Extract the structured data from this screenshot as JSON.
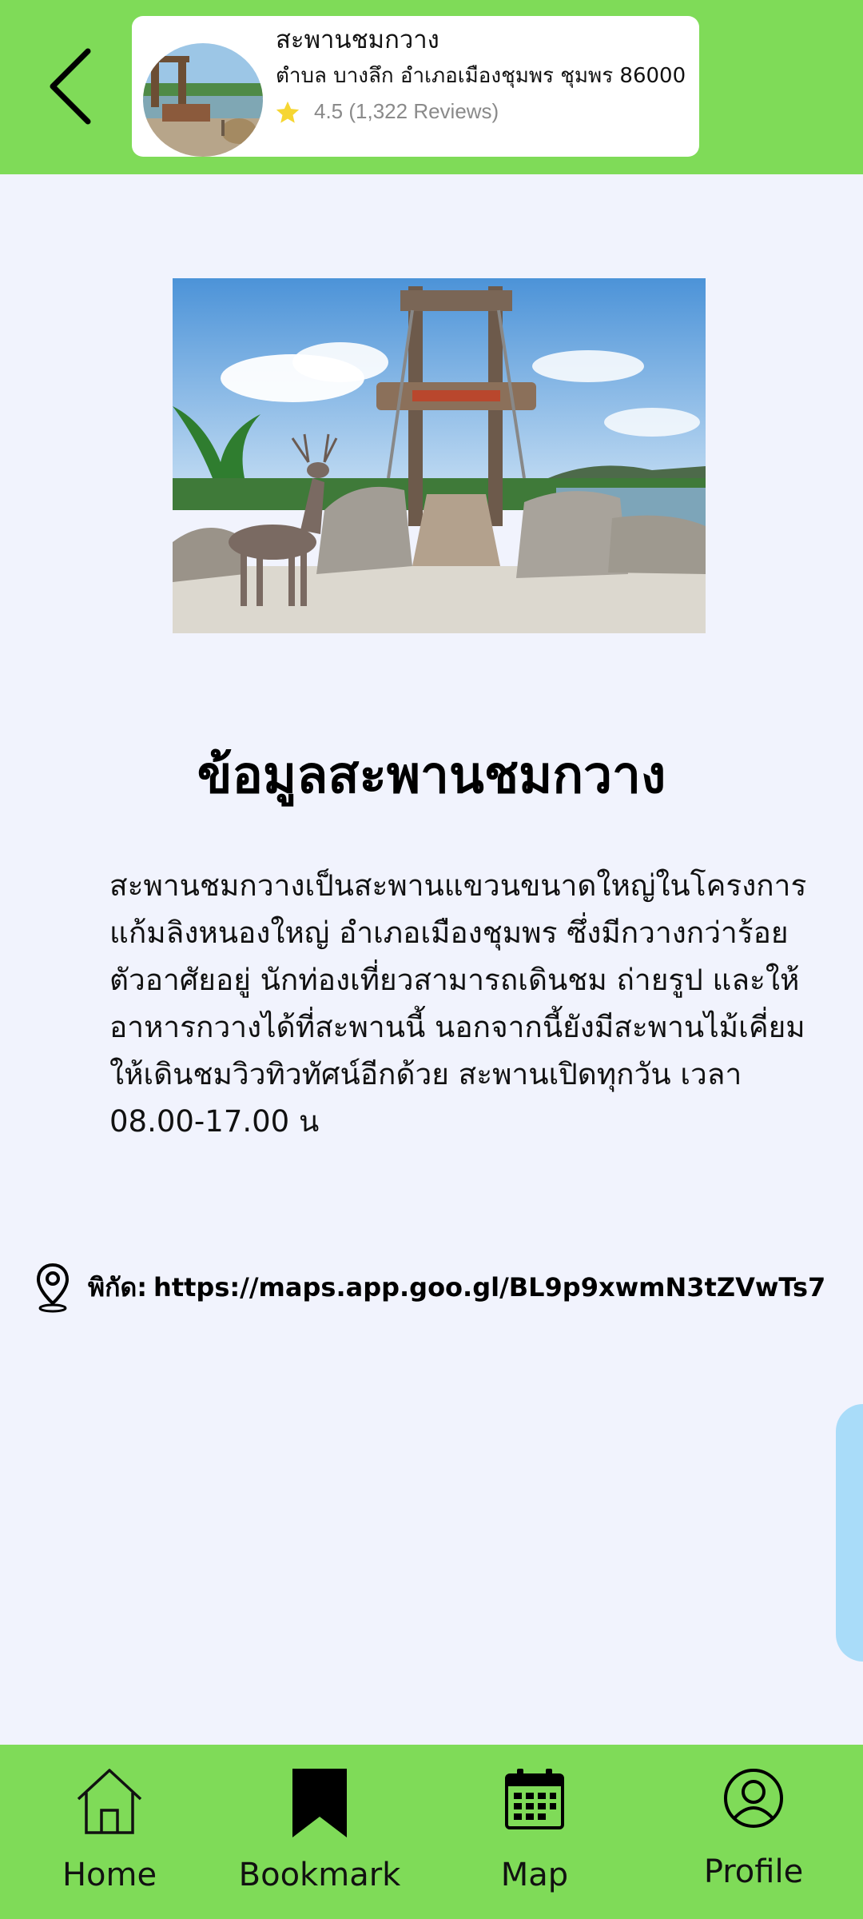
{
  "header": {
    "back_icon": "chevron-left-icon",
    "place": {
      "name": "สะพานชมกวาง",
      "address": "ตำบล บางลึก อำเภอเมืองชุมพร ชุมพร 86000",
      "rating_text": "4.5 (1,322 Reviews)",
      "rating_value": 4.5,
      "review_count": "1,322",
      "star_icon": "star-icon",
      "star_color": "#f6d632"
    }
  },
  "main": {
    "title": "ข้อมูลสะพานชมกวาง",
    "description": "สะพานชมกวางเป็นสะพานแขวนขนาดใหญ่ในโครงการแก้มลิงหนองใหญ่ อำเภอเมืองชุมพร ซึ่งมีกวางกว่าร้อยตัวอาศัยอยู่ นักท่องเที่ยวสามารถเดินชม ถ่ายรูป และให้อาหารกวางได้ที่สะพานนี้ นอกจากนี้ยังมีสะพานไม้เคี่ยมให้เดินชมวิวทิวทัศน์อีกด้วย สะพานเปิดทุกวัน เวลา 08.00-17.00 น",
    "coordinates": {
      "label": "พิกัด:",
      "url": "https://maps.app.goo.gl/BL9p9xwmN3tZVwTs7",
      "icon": "map-pin-icon"
    }
  },
  "bottom_nav": {
    "items": [
      {
        "label": "Home",
        "icon": "home-icon"
      },
      {
        "label": "Bookmark",
        "icon": "bookmark-icon"
      },
      {
        "label": "Map",
        "icon": "calendar-icon"
      },
      {
        "label": "Profile",
        "icon": "user-icon"
      }
    ]
  },
  "colors": {
    "header_bg": "#7fdb58",
    "page_bg": "#f1f3fd",
    "side_tab": "#a9dcf9"
  }
}
